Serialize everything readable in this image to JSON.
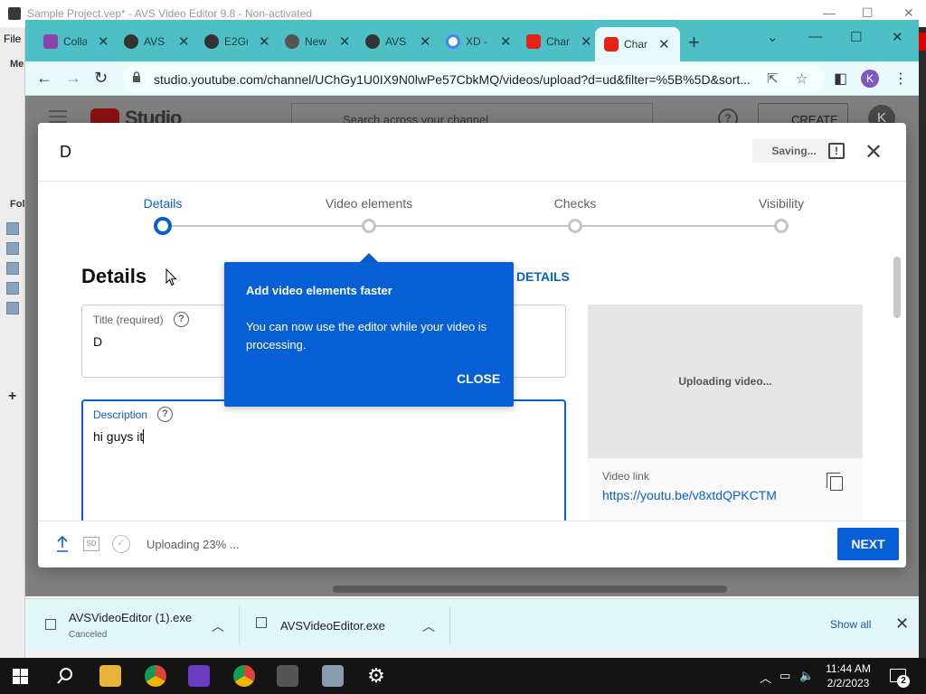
{
  "avs": {
    "window_title": "Sample Project.vep* - AVS Video Editor 9.8 - Non-activated",
    "menu_file": "File",
    "label_media": "Me",
    "label_folders": "Fol",
    "add_symbol": "+"
  },
  "browser": {
    "tabs": [
      {
        "label": "Colla",
        "favicon_color": "#8e44ad"
      },
      {
        "label": "AVS",
        "favicon_color": "#333333"
      },
      {
        "label": "E2Gu",
        "favicon_color": "#333333"
      },
      {
        "label": "New",
        "favicon_color": "#555555"
      },
      {
        "label": "AVS",
        "favicon_color": "#333333"
      },
      {
        "label": "XD -",
        "favicon_color": "#4285f4"
      },
      {
        "label": "Char",
        "favicon_color": "#e62117"
      },
      {
        "label": "Char",
        "favicon_color": "#e62117"
      }
    ],
    "new_tab_symbol": "+",
    "url": "studio.youtube.com/channel/UChGy1U0IX9N0lwPe57CbkMQ/videos/upload?d=ud&filter=%5B%5D&sort...",
    "profile_initial": "K",
    "accent_color": "#4ebfc5"
  },
  "studio": {
    "logo_text": "Studio",
    "search_placeholder": "Search across your channel",
    "help_symbol": "?",
    "create_label": "CREATE",
    "avatar_initial": "K"
  },
  "dialog": {
    "title": "D",
    "saving_label": "Saving...",
    "feedback_symbol": "!",
    "close_symbol": "✕",
    "steps": [
      {
        "label": "Details",
        "active": true
      },
      {
        "label": "Video elements",
        "active": false
      },
      {
        "label": "Checks",
        "active": false
      },
      {
        "label": "Visibility",
        "active": false
      }
    ],
    "section_title": "Details",
    "reuse_label": "DETAILS",
    "title_field": {
      "label": "Title (required)",
      "value": "D"
    },
    "description_field": {
      "label": "Description",
      "value": "hi guys it"
    },
    "help_symbol": "?",
    "preview_status": "Uploading video...",
    "video_link_label": "Video link",
    "video_link": "https://youtu.be/v8xtdQPKCTM",
    "footer": {
      "sd_label": "SD",
      "check_symbol": "✓",
      "upload_status": "Uploading 23% ...",
      "next_label": "NEXT"
    },
    "primary_color": "#065fd4"
  },
  "tooltip": {
    "title": "Add video elements faster",
    "body": "You can now use the editor while your video is processing.",
    "close_label": "CLOSE"
  },
  "downloads": [
    {
      "name": "AVSVideoEditor (1).exe",
      "status": "Canceled"
    },
    {
      "name": "AVSVideoEditor.exe",
      "status": ""
    }
  ],
  "downloads_show_all": "Show all",
  "taskbar": {
    "time": "11:44 AM",
    "date": "2/2/2023",
    "notification_count": "2",
    "tray_up_symbol": "︿",
    "volume_symbol": "🔈"
  }
}
